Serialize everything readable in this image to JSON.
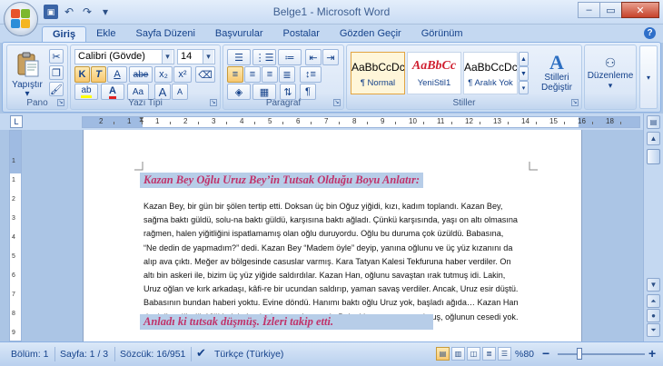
{
  "window": {
    "title": "Belge1 - Microsoft Word",
    "minimize_icon": "–",
    "maximize_icon": "▭",
    "close_icon": "✕"
  },
  "qat": {
    "save_icon": "💾",
    "undo_icon": "↶",
    "redo_icon": "↷",
    "customize_icon": "▾"
  },
  "tabs": [
    "Giriş",
    "Ekle",
    "Sayfa Düzeni",
    "Başvurular",
    "Postalar",
    "Gözden Geçir",
    "Görünüm"
  ],
  "ribbon": {
    "clipboard": {
      "label": "Pano",
      "paste": "Yapıştır",
      "paste_arrow": "▾"
    },
    "font": {
      "label": "Yazı Tipi",
      "font_name": "Calibri (Gövde)",
      "font_size": "14",
      "bold": "K",
      "italic": "T",
      "underline": "A",
      "strike": "abe",
      "subscript": "x₂",
      "superscript": "x²",
      "case": "Aa",
      "grow": "A",
      "shrink": "A"
    },
    "paragraph": {
      "label": "Paragraf",
      "show_marks": "¶"
    },
    "styles": {
      "label": "Stiller",
      "items": [
        {
          "sample": "AaBbCcDc",
          "name": "¶ Normal"
        },
        {
          "sample": "AaBbCc",
          "name": "YeniStil1"
        },
        {
          "sample": "AaBbCcDc",
          "name": "¶ Aralık Yok"
        }
      ],
      "change_styles": "Stilleri Değiştir",
      "change_arrow": "▾"
    },
    "editing": {
      "label": "Düzenleme",
      "arrow": "▾"
    }
  },
  "document": {
    "heading1": "Kazan Bey Oğlu Uruz Bey’in Tutsak Olduğu Boyu Anlatır:",
    "body_lines": [
      "Kazan Bey, bir gün bir şölen tertip etti. Doksan üç bin Oğuz yiğidi, kızı, kadım toplandı. Kazan Bey,",
      "sağma baktı güldü, solu-na baktı güldü, karşısına baktı ağladı. Çünkü karşısında, yaşı on altı olmasına",
      "rağmen, halen yiğitliğini ispatlamamış olan oğlu duruyordu. Oğlu bu duruma çok üzüldü. Babasına,",
      "“Ne dedin de yapmadım?” dedi. Kazan Bey “Madem öyle” deyip, yanına oğlunu ve üç yüz kızanını da",
      "alıp ava çıktı. Meğer av bölgesinde casuslar varmış. Kara Tatyan Kalesi Tekfuruna haber verdiler. On",
      "altı bin askeri ile, bizim üç yüz yiğide saldırdılar. Kazan Han, oğlunu savaştan ırak tutmuş idi. Lakin,",
      "Uruz oğlan ve kırk arkadaşı, kâfi-re bir ucundan saldırıp, yaman savaş verdiler. Ancak, Uruz esir düştü.",
      "Babasının bundan haberi yoktu. Evine döndü. Hanımı baktı oğlu Uruz yok, başladı ağıda… Kazan Han",
      "da deliye döndü. Yiğitlerini alıp, hızla av yerine vardı. Baktı ki yaman savaş olmuş, oğlunun cesedi yok."
    ],
    "heading2": "Anladı ki tutsak düşmüş. İzleri takip etti."
  },
  "ruler": {
    "tab_selector": "L",
    "numbers": [
      "2",
      "1",
      "1",
      "2",
      "3",
      "4",
      "5",
      "6",
      "7",
      "8",
      "9",
      "10",
      "11",
      "12",
      "13",
      "14",
      "15",
      "16",
      "18"
    ]
  },
  "statusbar": {
    "section": "Bölüm: 1",
    "page": "Sayfa: 1 / 3",
    "words": "Sözcük: 16/951",
    "language": "Türkçe (Türkiye)",
    "zoom": "%80",
    "zoom_out": "−",
    "zoom_in": "+"
  },
  "colors": {
    "accent": "#15428b",
    "heading_text": "#c0326a",
    "heading_highlight": "#b7cde8"
  }
}
